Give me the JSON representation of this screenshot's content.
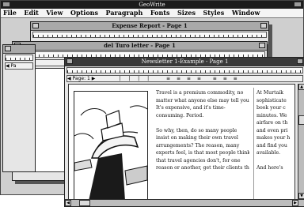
{
  "app": {
    "title": "GeoWrite"
  },
  "menu": [
    "File",
    "Edit",
    "View",
    "Options",
    "Paragraph",
    "Fonts",
    "Sizes",
    "Styles",
    "Window"
  ],
  "windows": {
    "back": {
      "title": "Expense Report - Page 1"
    },
    "mid": {
      "title": "del Turo letter - Page 1"
    },
    "front": {
      "title": "Newsletter 1-Example - Page 1",
      "page_label": "Page: 1",
      "col1": [
        "Travel is a premium commodity, no",
        "matter what anyone else may tell you.",
        "It's expensive, and it's time-",
        "consuming. Period.",
        "",
        "    So why, then, do so many people",
        "insist on making their own travel",
        "arrangements? The reason, many",
        "experts feel, is that most people think",
        "that travel agencies don't, for one",
        "reason or another, get their clients the"
      ],
      "col2": [
        "At Murtaik",
        "sophisticate",
        "book your c",
        "minutes. We",
        "airfare on th",
        "and even pri",
        "makes your h",
        "and find you",
        "available.",
        "",
        "    And here's"
      ]
    }
  }
}
